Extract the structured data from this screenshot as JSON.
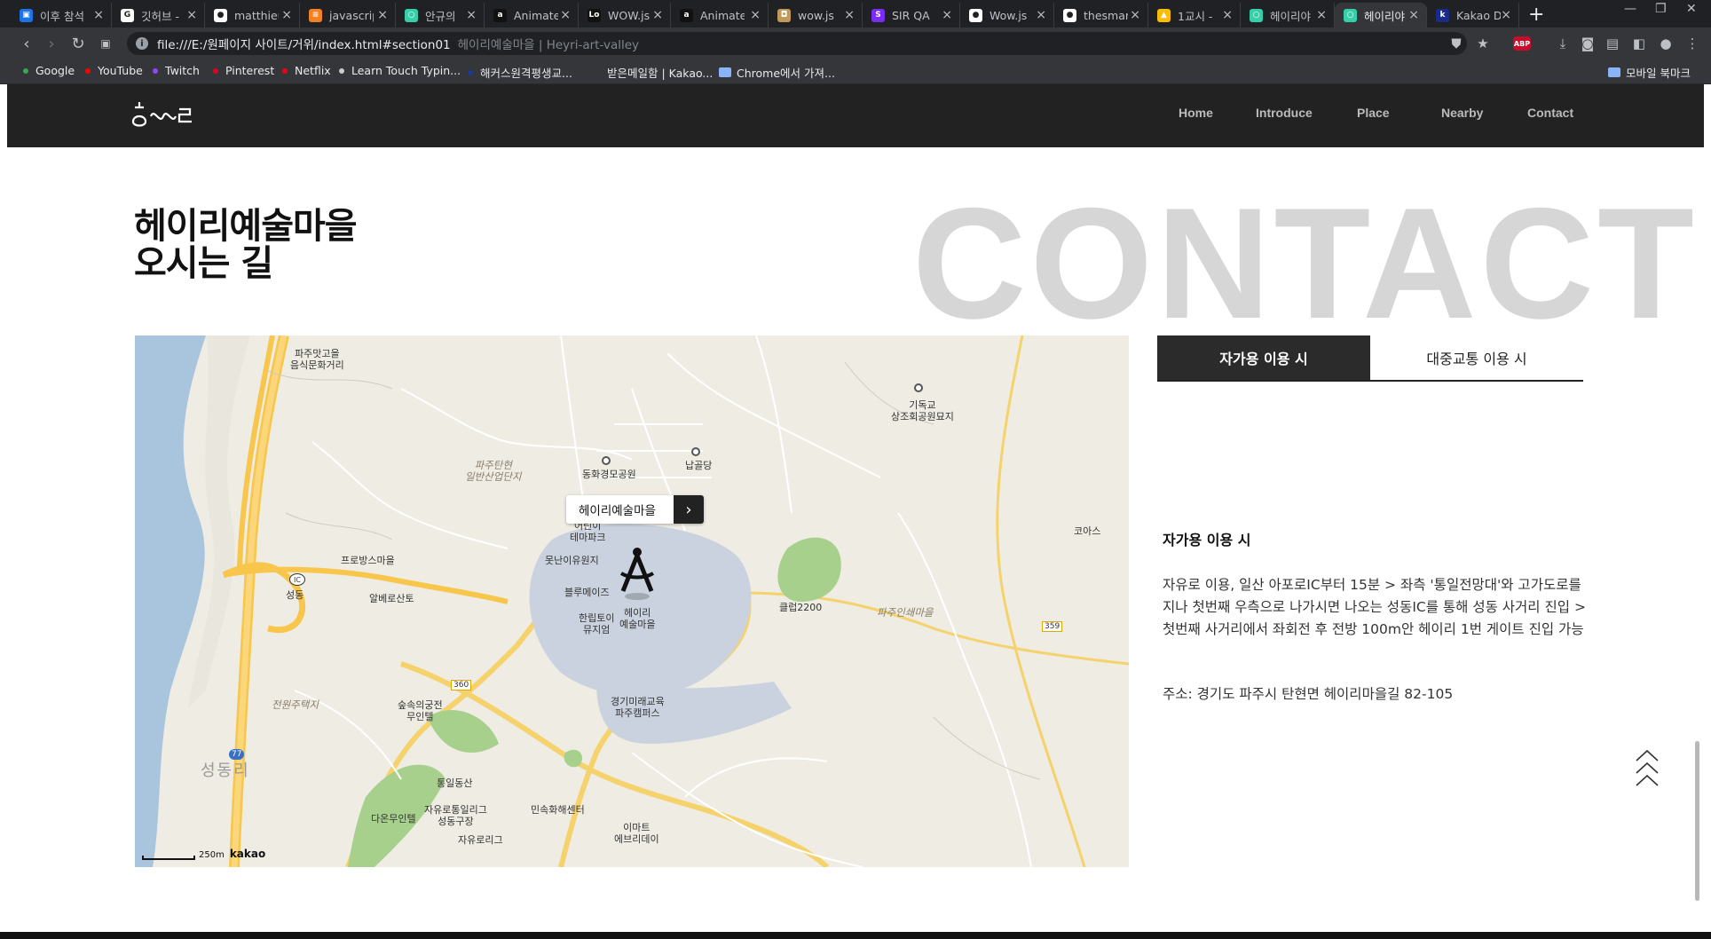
{
  "browser": {
    "tabs": [
      {
        "title": "이후 참석",
        "fav_color": "#1a73e8",
        "fav_glyph": "▣"
      },
      {
        "title": "깃허브 -",
        "fav_color": "#ffffff",
        "fav_glyph": "G"
      },
      {
        "title": "matthieu",
        "fav_color": "#ffffff",
        "fav_glyph": "●"
      },
      {
        "title": "javascrip",
        "fav_color": "#f48024",
        "fav_glyph": "≡"
      },
      {
        "title": "안규의",
        "fav_color": "#35d0a9",
        "fav_glyph": "○"
      },
      {
        "title": "Animate",
        "fav_color": "#111111",
        "fav_glyph": "a"
      },
      {
        "title": "WOW.js",
        "fav_color": "#111111",
        "fav_glyph": "Lo"
      },
      {
        "title": "Animate",
        "fav_color": "#111111",
        "fav_glyph": "a"
      },
      {
        "title": "wow.js",
        "fav_color": "#c19a5b",
        "fav_glyph": "◘"
      },
      {
        "title": "SIR QA",
        "fav_color": "#7b2cf4",
        "fav_glyph": "S"
      },
      {
        "title": "Wow.js",
        "fav_color": "#ffffff",
        "fav_glyph": "●"
      },
      {
        "title": "thesmar",
        "fav_color": "#ffffff",
        "fav_glyph": "●"
      },
      {
        "title": "1교시 -",
        "fav_color": "#fbbc04",
        "fav_glyph": "▲"
      },
      {
        "title": "헤이리야",
        "fav_color": "#35d0a9",
        "fav_glyph": "○"
      },
      {
        "title": "헤이리야",
        "fav_color": "#35d0a9",
        "fav_glyph": "○"
      },
      {
        "title": "Kakao D",
        "fav_color": "#1a2a8a",
        "fav_glyph": "k"
      }
    ],
    "close_glyph": "×",
    "new_tab_glyph": "+",
    "window_controls": [
      "—",
      "❐",
      "✕"
    ],
    "url": "file:///E:/원페이지 사이트/거위/index.html#section01",
    "page_title": "헤이리예술마을 | Heyri-art-valley",
    "abp_label": "ABP",
    "bookmarks": [
      {
        "label": "Google",
        "color": "#34a853"
      },
      {
        "label": "YouTube",
        "color": "#ff0000"
      },
      {
        "label": "Twitch",
        "color": "#9146ff"
      },
      {
        "label": "Pinterest",
        "color": "#e60023"
      },
      {
        "label": "Netflix",
        "color": "#e50914"
      },
      {
        "label": "Learn Touch Typin...",
        "color": "#cccccc"
      },
      {
        "label": "해커스원격평생교...",
        "color": "#1a3a9a"
      },
      {
        "label": "받은메일함 | Kakao...",
        "color": "#35363a"
      },
      {
        "label": "Chrome에서 가져...",
        "color": "folder"
      }
    ],
    "mobile_bookmarks": "모바일 북마크"
  },
  "site": {
    "logo_text": "heyri",
    "nav": [
      "Home",
      "Introduce",
      "Place",
      "Nearby",
      "Contact"
    ],
    "heading_line1": "헤이리예술마을",
    "heading_line2": "오시는 길",
    "background_word": "CONTACT"
  },
  "map": {
    "info_window": "헤이리예술마을",
    "info_arrow": "›",
    "scale_label": "250m",
    "brand": "kakao",
    "labels": {
      "food_street": [
        "파주맛고을",
        "음식문화거리"
      ],
      "giddokgyo": [
        "기독교",
        "상조회공원묘지"
      ],
      "donghwa": "동화경모공원",
      "napgoldang": "납골당",
      "industrial": [
        "파주탄현",
        "일반산업단지"
      ],
      "theme_park": [
        "어린이",
        "테마파크"
      ],
      "provence": "프로방스마을",
      "sungdong_ic": "IC",
      "sungdong": "성동",
      "albero": "알베로산토",
      "motnanyi": "못난이유원지",
      "blue": "블루메이즈",
      "hanlip": [
        "한립토이",
        "뮤지엄"
      ],
      "heyri_pin": [
        "헤이리",
        "예술마을"
      ],
      "club": "클럽2200",
      "koas": "코아스",
      "paju_print": "파주인쇄마을",
      "jeonwon": "전원주택지",
      "sup": [
        "숲속의궁전",
        "무인텔"
      ],
      "gyeonggi": [
        "경기미래교육",
        "파주캠퍼스"
      ],
      "tongil": "통일동산",
      "daon": "다온무인텔",
      "jayu_golf": [
        "자유로통일리그",
        "성동구장"
      ],
      "minsok": "민속화해센터",
      "emart": [
        "이마트",
        "에브리데이"
      ],
      "jayu_lorigi": "자유로리그",
      "seongdongri": "성동리",
      "road_77": "77",
      "road_360": "360",
      "road_359": "359"
    }
  },
  "transport": {
    "tabs": [
      "자가용 이용 시",
      "대중교통 이용 시"
    ],
    "active_tab": 0,
    "title": "자가용 이용 시",
    "body": "자유로 이용, 일산 아포로IC부터 15분 > 좌측 '통일전망대'와 고가도로를 지나 첫번째 우측으로 나가시면 나오는 성동IC를 통해 성동 사거리 진입 > 첫번째 사거리에서 좌회전 후 전방 100m안 헤이리 1번 게이트 진입 가능",
    "address": "주소: 경기도 파주시 탄현면 헤이리마을길 82-105"
  },
  "colors": {
    "nav_bg": "#222222",
    "tab_active_bg": "#2b2b2b",
    "bigword": "#d6d6d6"
  }
}
